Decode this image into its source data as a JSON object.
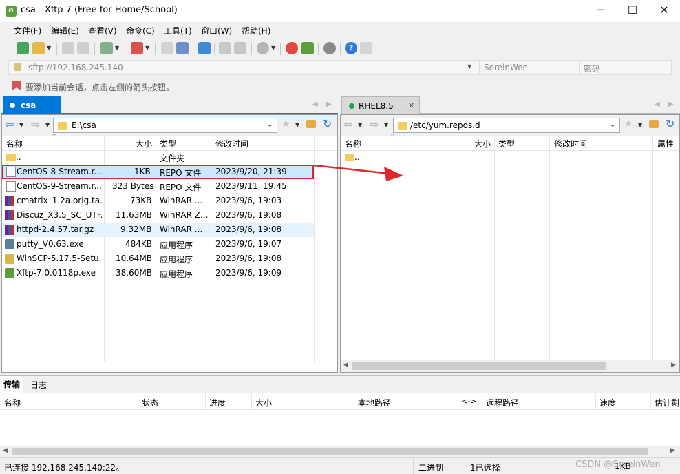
{
  "window": {
    "title": "csa - Xftp 7 (Free for Home/School)",
    "app_icon": "xftp-logo-icon"
  },
  "menu": [
    "文件(F)",
    "编辑(E)",
    "查看(V)",
    "命令(C)",
    "工具(T)",
    "窗口(W)",
    "帮助(H)"
  ],
  "address": {
    "url": "sftp://192.168.245.140",
    "username": "SereinWen",
    "password_placeholder": "密码"
  },
  "hint": "要添加当前会话，点击左侧的箭头按钮。",
  "left_tab": {
    "label": "csa"
  },
  "right_tab": {
    "label": "RHEL8.5"
  },
  "left_pane": {
    "path": "E:\\csa",
    "columns": [
      "名称",
      "大小",
      "类型",
      "修改时间"
    ],
    "rows": [
      {
        "name": "..",
        "size": "",
        "type": "文件夹",
        "modified": "",
        "icon": "folder-icon"
      },
      {
        "name": "CentOS-8-Stream.r...",
        "size": "1KB",
        "type": "REPO 文件",
        "modified": "2023/9/20, 21:39",
        "icon": "file-icon",
        "selected": true
      },
      {
        "name": "CentOS-9-Stream.r...",
        "size": "323 Bytes",
        "type": "REPO 文件",
        "modified": "2023/9/11, 19:45",
        "icon": "file-icon"
      },
      {
        "name": "cmatrix_1.2a.orig.ta...",
        "size": "73KB",
        "type": "WinRAR ...",
        "modified": "2023/9/6, 19:03",
        "icon": "winrar-icon"
      },
      {
        "name": "Discuz_X3.5_SC_UTF...",
        "size": "11.63MB",
        "type": "WinRAR Z...",
        "modified": "2023/9/6, 19:08",
        "icon": "winrar-icon"
      },
      {
        "name": "httpd-2.4.57.tar.gz",
        "size": "9.32MB",
        "type": "WinRAR ...",
        "modified": "2023/9/6, 19:08",
        "icon": "winrar-icon",
        "hover": true
      },
      {
        "name": "putty_V0.63.exe",
        "size": "484KB",
        "type": "应用程序",
        "modified": "2023/9/6, 19:07",
        "icon": "putty-icon"
      },
      {
        "name": "WinSCP-5.17.5-Setu...",
        "size": "10.64MB",
        "type": "应用程序",
        "modified": "2023/9/6, 19:08",
        "icon": "winscp-icon"
      },
      {
        "name": "Xftp-7.0.0118p.exe",
        "size": "38.60MB",
        "type": "应用程序",
        "modified": "2023/9/6, 19:09",
        "icon": "xftp-icon"
      }
    ]
  },
  "right_pane": {
    "path": "/etc/yum.repos.d",
    "columns": [
      "名称",
      "大小",
      "类型",
      "修改时间",
      "属性"
    ],
    "rows": [
      {
        "name": "..",
        "icon": "folder-icon"
      }
    ]
  },
  "bottom_tabs": [
    "传输",
    "日志"
  ],
  "transfer_columns": [
    "名称",
    "状态",
    "进度",
    "大小",
    "本地路径",
    "<->",
    "远程路径",
    "速度",
    "估计剩"
  ],
  "status": {
    "connection": "已连接 192.168.245.140:22。",
    "mode": "二进制",
    "selection": "1已选择",
    "size": "1KB"
  },
  "watermark": "CSDN @SereinWen",
  "colors": {
    "accent_tab": "#0078d7",
    "selection_border": "#d9262c",
    "arrow": "#e0262a",
    "hover_row": "#cce8ff"
  }
}
